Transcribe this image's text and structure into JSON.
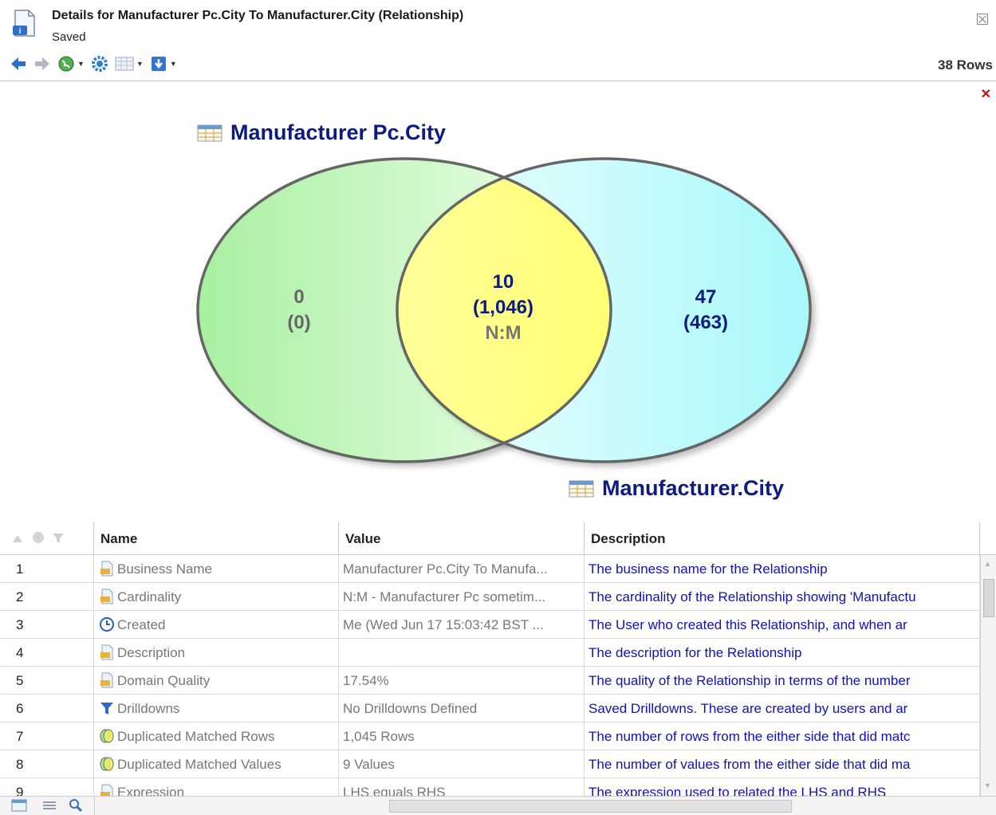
{
  "window": {
    "title": "Details for Manufacturer Pc.City To Manufacturer.City (Relationship)",
    "status": "Saved",
    "row_count": "38 Rows",
    "close_icon": "close-icon"
  },
  "toolbar": {
    "icons": [
      "back-arrow-icon",
      "forward-arrow-icon",
      "globe-icon",
      "gear-icon",
      "grid-icon",
      "export-icon"
    ]
  },
  "venn": {
    "left_label": "Manufacturer Pc.City",
    "right_label": "Manufacturer.City",
    "left_count": "0",
    "left_rows": "(0)",
    "overlap_count": "10",
    "overlap_rows": "(1,046)",
    "overlap_cardinality": "N:M",
    "right_count": "47",
    "right_rows": "(463)",
    "colors": {
      "left": "#a8f0a0",
      "overlap": "#ffff70",
      "right": "#a8f8fa",
      "label": "#0d1a80"
    }
  },
  "grid": {
    "headers": {
      "name": "Name",
      "value": "Value",
      "description": "Description"
    },
    "rows": [
      {
        "num": "1",
        "icon": "document-icon",
        "name": "Business Name",
        "value": "Manufacturer Pc.City To Manufa...",
        "description": "The business name for the Relationship"
      },
      {
        "num": "2",
        "icon": "document-icon",
        "name": "Cardinality",
        "value": "N:M - Manufacturer Pc sometim...",
        "description": "The cardinality of the Relationship showing 'Manufactu"
      },
      {
        "num": "3",
        "icon": "clock-icon",
        "name": "Created",
        "value": "Me (Wed Jun 17 15:03:42 BST ...",
        "description": "The User who created this Relationship, and when ar"
      },
      {
        "num": "4",
        "icon": "document-icon",
        "name": "Description",
        "value": "",
        "description": "The description for the Relationship"
      },
      {
        "num": "5",
        "icon": "document-icon",
        "name": "Domain Quality",
        "value": "17.54%",
        "description": "The quality of the Relationship in terms of the number"
      },
      {
        "num": "6",
        "icon": "filter-icon",
        "name": "Drilldowns",
        "value": "No Drilldowns Defined",
        "description": "Saved Drilldowns. These are created by users and ar"
      },
      {
        "num": "7",
        "icon": "venn-icon",
        "name": "Duplicated Matched Rows",
        "value": "1,045 Rows",
        "description": "The number of rows from the either side that did matc"
      },
      {
        "num": "8",
        "icon": "venn-icon",
        "name": "Duplicated Matched Values",
        "value": "9 Values",
        "description": "The number of values from the either side that did ma"
      },
      {
        "num": "9",
        "icon": "document-icon",
        "name": "Expression",
        "value": "LHS equals RHS",
        "description": "The expression used to related the LHS and RHS"
      }
    ]
  }
}
